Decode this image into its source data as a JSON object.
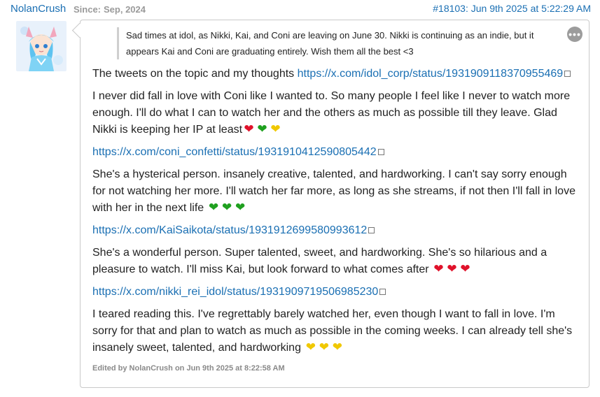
{
  "post": {
    "username": "NolanCrush",
    "since_label": "Since:",
    "since_value": "Sep, 2024",
    "permalink": "#18103: Jun 9th 2025 at 5:22:29 AM",
    "menu_label": "•••",
    "quote": "Sad times at idol, as Nikki, Kai, and Coni are leaving on June 30. Nikki is continuing as an indie, but it appears Kai and Coni are graduating entirely. Wish them all the best <3",
    "paragraphs": {
      "p1_text": "The tweets on the topic and my thoughts ",
      "p1_link": "https://x.com/idol_corp/status/1931909118370955469",
      "p2_text": "I never did fall in love with Coni like I wanted to. So many people I feel like I never to watch more enough. I'll do what I can to watch her and the others as much as possible till they leave. Glad Nikki is keeping her IP at least",
      "link2": "https://x.com/coni_confetti/status/1931910412590805442",
      "p3_text": "She's a hysterical person. insanely creative, talented, and hardworking. I can't say sorry enough for not watching her more. I'll watch her far more, as long as she streams, if not then I'll fall in love with her in the next life ",
      "link3": "https://x.com/KaiSaikota/status/1931912699580993612",
      "p4_text": "She's a wonderful person. Super talented, sweet, and hardworking. She's so hilarious and a pleasure to watch. I'll miss Kai, but look forward to what comes after ",
      "link4": "https://x.com/nikki_rei_idol/status/1931909719506985230",
      "p5_text": "I teared reading this. I've regrettably barely watched her, even though I want to fall in love. I'm sorry for that and plan to watch as much as possible in the coming weeks. I can already tell she's insanely sweet, talented, and hardworking "
    },
    "hearts": {
      "p2": [
        "red",
        "green",
        "yellow"
      ],
      "p3": [
        "green",
        "green",
        "green"
      ],
      "p4": [
        "red",
        "red",
        "red"
      ],
      "p5": [
        "yellow",
        "yellow",
        "yellow"
      ]
    },
    "edited": "Edited by NolanCrush on Jun 9th 2025 at 8:22:58 AM"
  },
  "colors": {
    "link": "#1a6fb3",
    "heart_red": "#e0122b",
    "heart_green": "#1fa01f",
    "heart_yellow": "#f0c800"
  },
  "icons": {
    "avatar": "anime-avatar",
    "menu": "more-options-icon",
    "external": "external-link-icon",
    "heart": "heart-emoji"
  }
}
